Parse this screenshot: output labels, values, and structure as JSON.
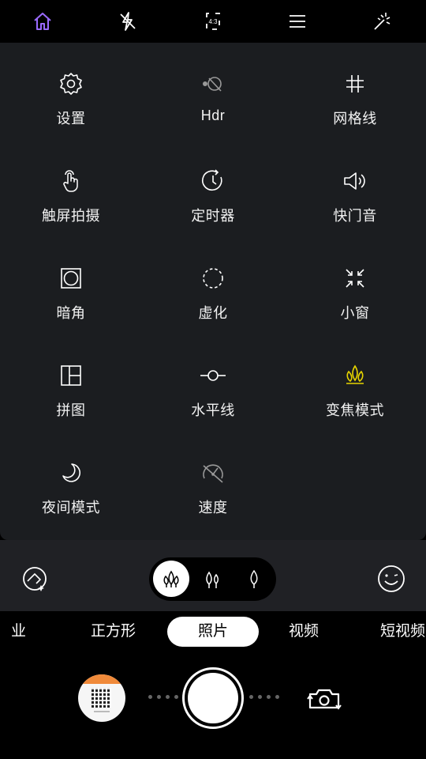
{
  "top_bar": {
    "aspect_ratio": "4:3",
    "active_color": "#9b6bff",
    "icons": [
      "home-icon",
      "flash-off-icon",
      "aspect-ratio-icon",
      "menu-icon",
      "effects-icon"
    ]
  },
  "settings_grid": [
    {
      "label": "设置",
      "icon": "settings-icon"
    },
    {
      "label": "Hdr",
      "icon": "hdr-icon"
    },
    {
      "label": "网格线",
      "icon": "grid-lines-icon"
    },
    {
      "label": "触屏拍摄",
      "icon": "touch-capture-icon"
    },
    {
      "label": "定时器",
      "icon": "timer-icon"
    },
    {
      "label": "快门音",
      "icon": "shutter-sound-icon"
    },
    {
      "label": "暗角",
      "icon": "vignette-icon"
    },
    {
      "label": "虚化",
      "icon": "blur-icon"
    },
    {
      "label": "小窗",
      "icon": "small-window-icon"
    },
    {
      "label": "拼图",
      "icon": "collage-icon"
    },
    {
      "label": "水平线",
      "icon": "horizon-line-icon"
    },
    {
      "label": "变焦模式",
      "icon": "zoom-mode-icon"
    },
    {
      "label": "夜间模式",
      "icon": "night-mode-icon"
    },
    {
      "label": "速度",
      "icon": "speed-icon"
    }
  ],
  "highlight_color": "#e6d400",
  "beauty_levels": {
    "selected": 0,
    "count": 3
  },
  "modes": [
    {
      "label": "业",
      "selected": false
    },
    {
      "label": "正方形",
      "selected": false
    },
    {
      "label": "照片",
      "selected": true
    },
    {
      "label": "视频",
      "selected": false
    },
    {
      "label": "短视频",
      "selected": false
    }
  ]
}
